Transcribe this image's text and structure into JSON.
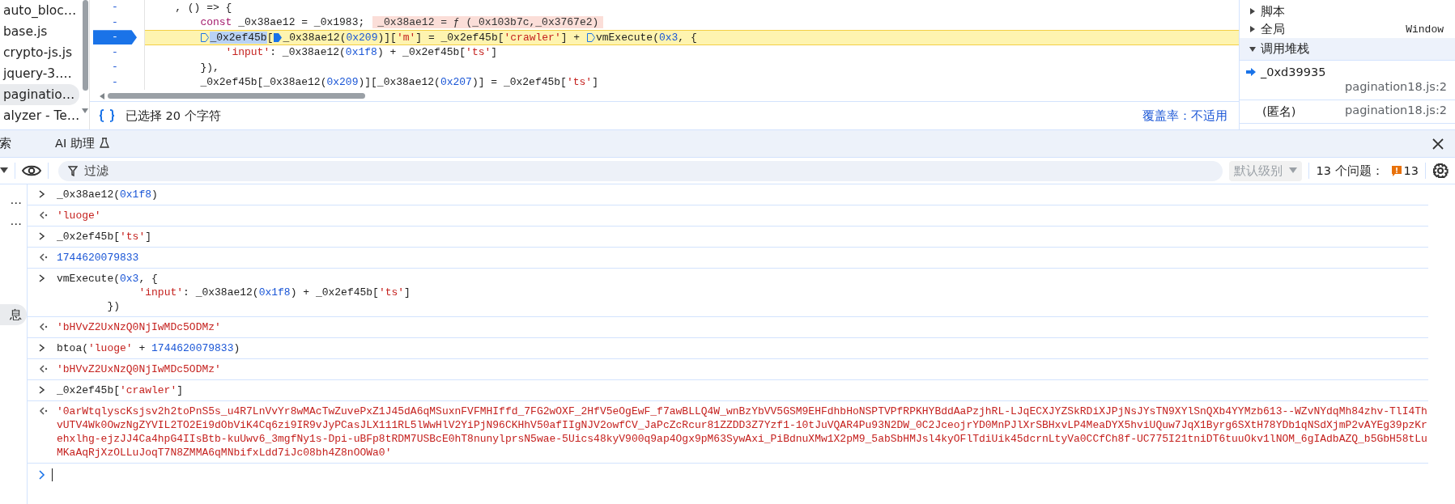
{
  "sources": {
    "files": [
      {
        "name": "auto_bloc…",
        "selected": false
      },
      {
        "name": "base.js",
        "selected": false
      },
      {
        "name": "crypto-js.js",
        "selected": false
      },
      {
        "name": "jquery-3.…",
        "selected": false
      },
      {
        "name": "paginatio…",
        "selected": true
      },
      {
        "name": "alyzer - Te…",
        "selected": false
      }
    ],
    "code_lines": [
      {
        "gutter": "-",
        "breakpoint": false,
        "current": false,
        "tokens": [
          {
            "text": "    , () => {",
            "kind": "plain"
          }
        ]
      },
      {
        "gutter": "-",
        "breakpoint": false,
        "current": false,
        "tokens": [
          {
            "text": "        const",
            "kind": "keyword"
          },
          {
            "text": " _0x38ae12 = _0x1983;",
            "kind": "plain"
          },
          {
            "text": "_0x38ae12 = ƒ (_0x103b7c,_0x3767e2)",
            "kind": "inline-value"
          }
        ]
      },
      {
        "gutter": "-",
        "breakpoint": true,
        "current": true,
        "tokens": [
          {
            "kind": "marker",
            "active": false
          },
          {
            "text": "_0x2ef45b",
            "kind": "selected"
          },
          {
            "text": "[",
            "kind": "plain"
          },
          {
            "kind": "marker",
            "active": true
          },
          {
            "text": "_0x38ae12(",
            "kind": "plain"
          },
          {
            "text": "0x209",
            "kind": "number"
          },
          {
            "text": ")][",
            "kind": "plain"
          },
          {
            "text": "'m'",
            "kind": "string"
          },
          {
            "text": "] = _0x2ef45b[",
            "kind": "plain"
          },
          {
            "text": "'crawler'",
            "kind": "string"
          },
          {
            "text": "] + ",
            "kind": "plain"
          },
          {
            "kind": "marker",
            "active": false
          },
          {
            "text": "vmExecute(",
            "kind": "plain"
          },
          {
            "text": "0x3",
            "kind": "number"
          },
          {
            "text": ", {",
            "kind": "plain"
          }
        ]
      },
      {
        "gutter": "-",
        "breakpoint": false,
        "current": false,
        "tokens": [
          {
            "text": "            'input'",
            "kind": "string"
          },
          {
            "text": ": _0x38ae12(",
            "kind": "plain"
          },
          {
            "text": "0x1f8",
            "kind": "number"
          },
          {
            "text": ") + _0x2ef45b[",
            "kind": "plain"
          },
          {
            "text": "'ts'",
            "kind": "string"
          },
          {
            "text": "]",
            "kind": "plain"
          }
        ]
      },
      {
        "gutter": "-",
        "breakpoint": false,
        "current": false,
        "tokens": [
          {
            "text": "        }),",
            "kind": "plain"
          }
        ]
      },
      {
        "gutter": "-",
        "breakpoint": false,
        "current": false,
        "tokens": [
          {
            "text": "        _0x2ef45b[_0x38ae12(",
            "kind": "plain"
          },
          {
            "text": "0x209",
            "kind": "number"
          },
          {
            "text": ")][_0x38ae12(",
            "kind": "plain"
          },
          {
            "text": "0x207",
            "kind": "number"
          },
          {
            "text": ")] = _0x2ef45b[",
            "kind": "plain"
          },
          {
            "text": "'ts'",
            "kind": "string"
          },
          {
            "text": "]",
            "kind": "plain"
          }
        ]
      }
    ],
    "status": {
      "selection": "已选择 20 个字符",
      "coverage": "覆盖率：不适用"
    }
  },
  "debugger": {
    "sections": [
      {
        "label": "脚本",
        "expanded": false
      },
      {
        "label": "全局",
        "expanded": false,
        "value": "Window"
      },
      {
        "label": "调用堆栈",
        "expanded": true
      }
    ],
    "call_stack": [
      {
        "function": "_0xd39935",
        "location": "pagination18.js:2",
        "current": true
      },
      {
        "function": "(匿名)",
        "location": "pagination18.js:2",
        "current": false
      }
    ]
  },
  "drawer": {
    "tabs": [
      {
        "label": "索",
        "selected": false
      },
      {
        "label": "AI 助理",
        "selected": false
      }
    ]
  },
  "console_toolbar": {
    "filter_placeholder": "过滤",
    "level": "默认级别",
    "level_disabled": true,
    "issues_label": "13 个问题：",
    "issues_count": "13"
  },
  "console_sidebar": {
    "items": [
      {
        "label": "…",
        "selected": false
      },
      {
        "label": "…",
        "selected": false
      },
      {
        "label": "息",
        "selected": true
      }
    ]
  },
  "console": {
    "messages": [
      {
        "kind": "input",
        "lines": [
          [
            {
              "text": "_0x38ae12(",
              "kind": "plain"
            },
            {
              "text": "0x1f8",
              "kind": "number"
            },
            {
              "text": ")",
              "kind": "plain"
            }
          ]
        ]
      },
      {
        "kind": "output",
        "lines": [
          [
            {
              "text": "'luoge'",
              "kind": "string"
            }
          ]
        ]
      },
      {
        "kind": "input",
        "lines": [
          [
            {
              "text": "_0x2ef45b[",
              "kind": "plain"
            },
            {
              "text": "'ts'",
              "kind": "string"
            },
            {
              "text": "]",
              "kind": "plain"
            }
          ]
        ]
      },
      {
        "kind": "output",
        "lines": [
          [
            {
              "text": "1744620079833",
              "kind": "number"
            }
          ]
        ]
      },
      {
        "kind": "input",
        "lines": [
          [
            {
              "text": "vmExecute(",
              "kind": "plain"
            },
            {
              "text": "0x3",
              "kind": "number"
            },
            {
              "text": ", {",
              "kind": "plain"
            }
          ],
          [
            {
              "text": "             'input'",
              "kind": "string"
            },
            {
              "text": ": _0x38ae12(",
              "kind": "plain"
            },
            {
              "text": "0x1f8",
              "kind": "number"
            },
            {
              "text": ") + _0x2ef45b[",
              "kind": "plain"
            },
            {
              "text": "'ts'",
              "kind": "string"
            },
            {
              "text": "]",
              "kind": "plain"
            }
          ],
          [
            {
              "text": "        })",
              "kind": "plain"
            }
          ]
        ]
      },
      {
        "kind": "output",
        "lines": [
          [
            {
              "text": "'bHVvZ2UxNzQ0NjIwMDc5ODMz'",
              "kind": "string"
            }
          ]
        ]
      },
      {
        "kind": "input",
        "lines": [
          [
            {
              "text": "btoa(",
              "kind": "plain"
            },
            {
              "text": "'luoge'",
              "kind": "string"
            },
            {
              "text": " + ",
              "kind": "plain"
            },
            {
              "text": "1744620079833",
              "kind": "number"
            },
            {
              "text": ")",
              "kind": "plain"
            }
          ]
        ]
      },
      {
        "kind": "output",
        "lines": [
          [
            {
              "text": "'bHVvZ2UxNzQ0NjIwMDc5ODMz'",
              "kind": "string"
            }
          ]
        ]
      },
      {
        "kind": "input",
        "lines": [
          [
            {
              "text": "_0x2ef45b[",
              "kind": "plain"
            },
            {
              "text": "'crawler'",
              "kind": "string"
            },
            {
              "text": "]",
              "kind": "plain"
            }
          ]
        ]
      },
      {
        "kind": "output",
        "lines": [
          [
            {
              "text": "'0arWtqlyscKsjsv2h2toPnS5s_u4R7LnVvYr8wMAcTwZuvePxZ1J45dA6qMSuxnFVFMHIffd_7FG2wOXF_2HfV5eOgEwF_f7awBLLQ4W_wnBzYbVV5GSM9EHFdhbHoNSPTVPfRPKHYBddAaPzjhRL-LJqECXJYZSkRDiXJPjNsJYsTN9XYlSnQXb4YYMzb613--WZvNYdqMh84zhv-TlI4ThvUTV4Wk0OwzNgZYVIL2TO2Ei9dObViK4Cq6zi9IR9vJyPCasJLX111RL5lWwHlV2YiPjN96CKHhV50afIIgNJV2owfCV_JaPcZcRcur81ZZDD3Z7Yzf1-10tJuVQAR4Pu93N2DW_0C2JceojrYD0MnPJlXrSBHxvLP4MeaDYX5hviUQuw7JqX1Byrg6SXtH78YDb1qNSdXjmP2vAYEg39pzKrehxlhg-ejzJJ4Ca4hpG4IIsBtb-kuUwv6_3mgfNy1s-Dpi-uBFp8tRDM7USBcE0hT8nunylprsN5wae-5Uics48kyV900q9ap4Ogx9pM63SywAxi_PiBdnuXMw1X2pM9_5abSbHMJsl4kyOFlTdiUik45dcrnLtyVa0CCfCh8f-UC775I21tniDT6tuuOkv1lNOM_6gIAdbAZQ_b5GbH58tLuMKaAqRjXzOLLuJoqT7N8ZMMA6qMNbifxLdd7iJc08bh4Z8nOOWa0'",
              "kind": "string"
            }
          ]
        ]
      }
    ]
  }
}
